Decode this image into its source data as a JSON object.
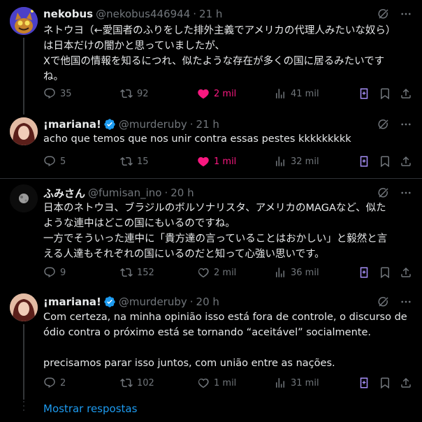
{
  "posts": [
    {
      "name": "nekobus",
      "handle": "@nekobus446944",
      "time": "21 h",
      "verified": false,
      "text": "ネトウヨ（←愛国者のふりをした排外主義でアメリカの代理人みたいな奴ら）\nは日本だけの闇かと思っていましたが、\nXで他国の情報を知るにつれ、似たような存在が多くの国に居るみたいです\nね。",
      "replies": "35",
      "reposts": "92",
      "likes": "2 mil",
      "views": "41 mil",
      "liked": true
    },
    {
      "name": "¡mariana!",
      "handle": "@murderuby",
      "time": "21 h",
      "verified": true,
      "text": "acho que temos que nos unir contra essas pestes kkkkkkkkk",
      "replies": "5",
      "reposts": "15",
      "likes": "1 mil",
      "views": "32 mil",
      "liked": true
    },
    {
      "name": "ふみさん",
      "handle": "@fumisan_ino",
      "time": "20 h",
      "verified": false,
      "text": "日本のネトウヨ、ブラジルのボルソナリスタ、アメリカのMAGAなど、似た\nような連中はどこの国にもいるのですね。\n一方でそういった連中に「貴方達の言っていることはおかしい」と毅然と言\nえる人達もそれぞれの国にいるのだと知って心強い思いです。",
      "replies": "9",
      "reposts": "152",
      "likes": "2 mil",
      "views": "36 mil",
      "liked": false
    },
    {
      "name": "¡mariana!",
      "handle": "@murderuby",
      "time": "20 h",
      "verified": true,
      "text": "Com certeza, na minha opinião isso está fora de controle, o discurso de\nódio contra o próximo está se tornando “aceitável” socialmente.\n\nprecisamos parar isso juntos, com união entre as nações.",
      "replies": "2",
      "reposts": "102",
      "likes": "1 mil",
      "views": "31 mil",
      "liked": false
    }
  ],
  "show_replies": "Mostrar respostas",
  "colors": {
    "accent": "#1d9bf0",
    "like": "#f91880",
    "muted": "#71767b",
    "grok": "#a58ef6"
  },
  "icons": [
    "grok-icon",
    "more-icon",
    "reply-icon",
    "repost-icon",
    "like-icon",
    "views-icon",
    "grok-post-icon",
    "bookmark-icon",
    "share-icon",
    "verified-icon"
  ]
}
